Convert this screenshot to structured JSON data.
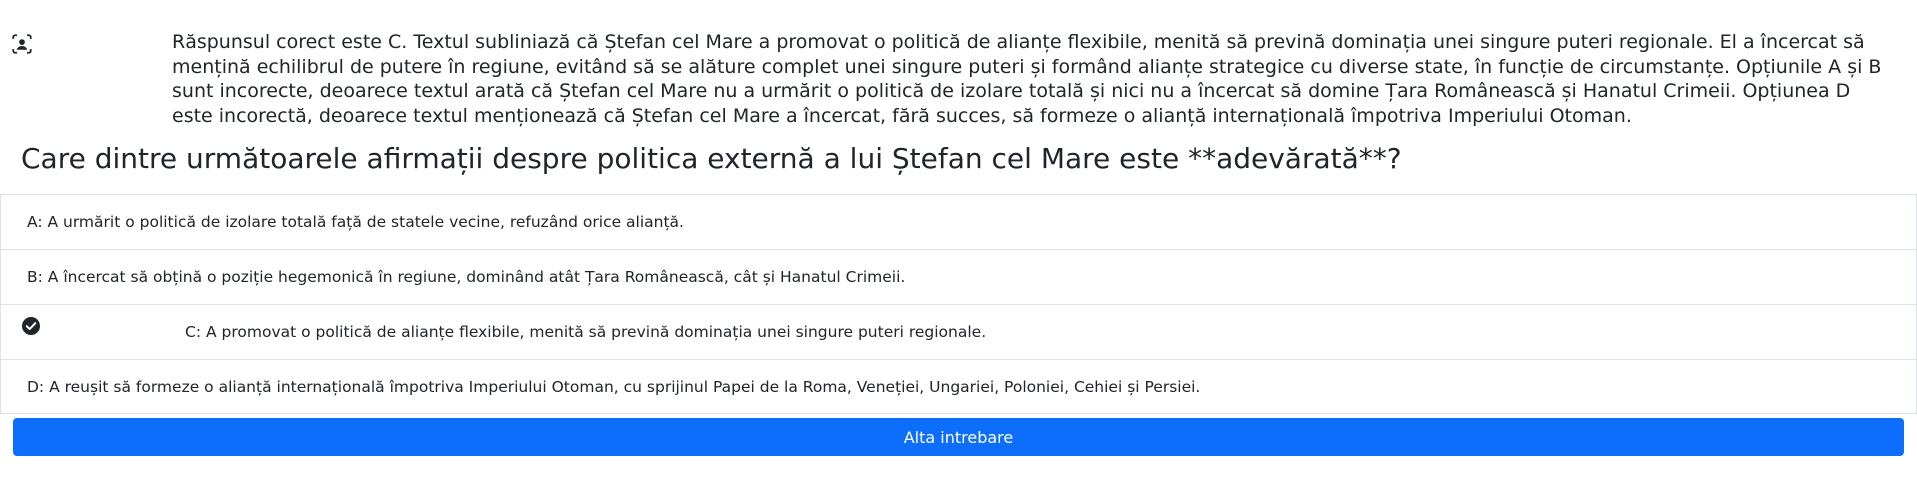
{
  "explanation": {
    "icon": "person-viewfinder-icon",
    "text": "Răspunsul corect este C. Textul subliniază că Ștefan cel Mare a promovat o politică de alianțe flexibile, menită să prevină dominația unei singure puteri regionale. El a încercat să mențină echilibrul de putere în regiune, evitând să se alăture complet unei singure puteri și formând alianțe strategice cu diverse state, în funcție de circumstanțe. Opțiunile A și B sunt incorecte, deoarece textul arată că Ștefan cel Mare nu a urmărit o politică de izolare totală și nici nu a încercat să domine Țara Românească și Hanatul Crimeii. Opțiunea D este incorectă, deoarece textul menționează că Ștefan cel Mare a încercat, fără succes, să formeze o alianță internațională împotriva Imperiului Otoman."
  },
  "question": {
    "title": "Care dintre următoarele afirmații despre politica externă a lui Ștefan cel Mare este **adevărată**?"
  },
  "answers": [
    {
      "label": "A: A urmărit o politică de izolare totală față de statele vecine, refuzând orice alianță."
    },
    {
      "label": "B: A încercat să obțină o poziție hegemonică în regiune, dominând atât Țara Românească, cât și Hanatul Crimeii."
    },
    {
      "label": "C: A promovat o politică de alianțe flexibile, menită să prevină dominația unei singure puteri regionale.",
      "selected": true,
      "icon": "check-circle-fill-icon"
    },
    {
      "label": "D: A reușit să formeze o alianță internațională împotriva Imperiului Otoman, cu sprijinul Papei de la Roma, Veneției, Ungariei, Poloniei, Cehiei și Persiei."
    }
  ],
  "actions": {
    "next_label": "Alta intrebare"
  },
  "colors": {
    "primary": "#0d6efd",
    "border": "#dee2e6",
    "text": "#212529"
  }
}
